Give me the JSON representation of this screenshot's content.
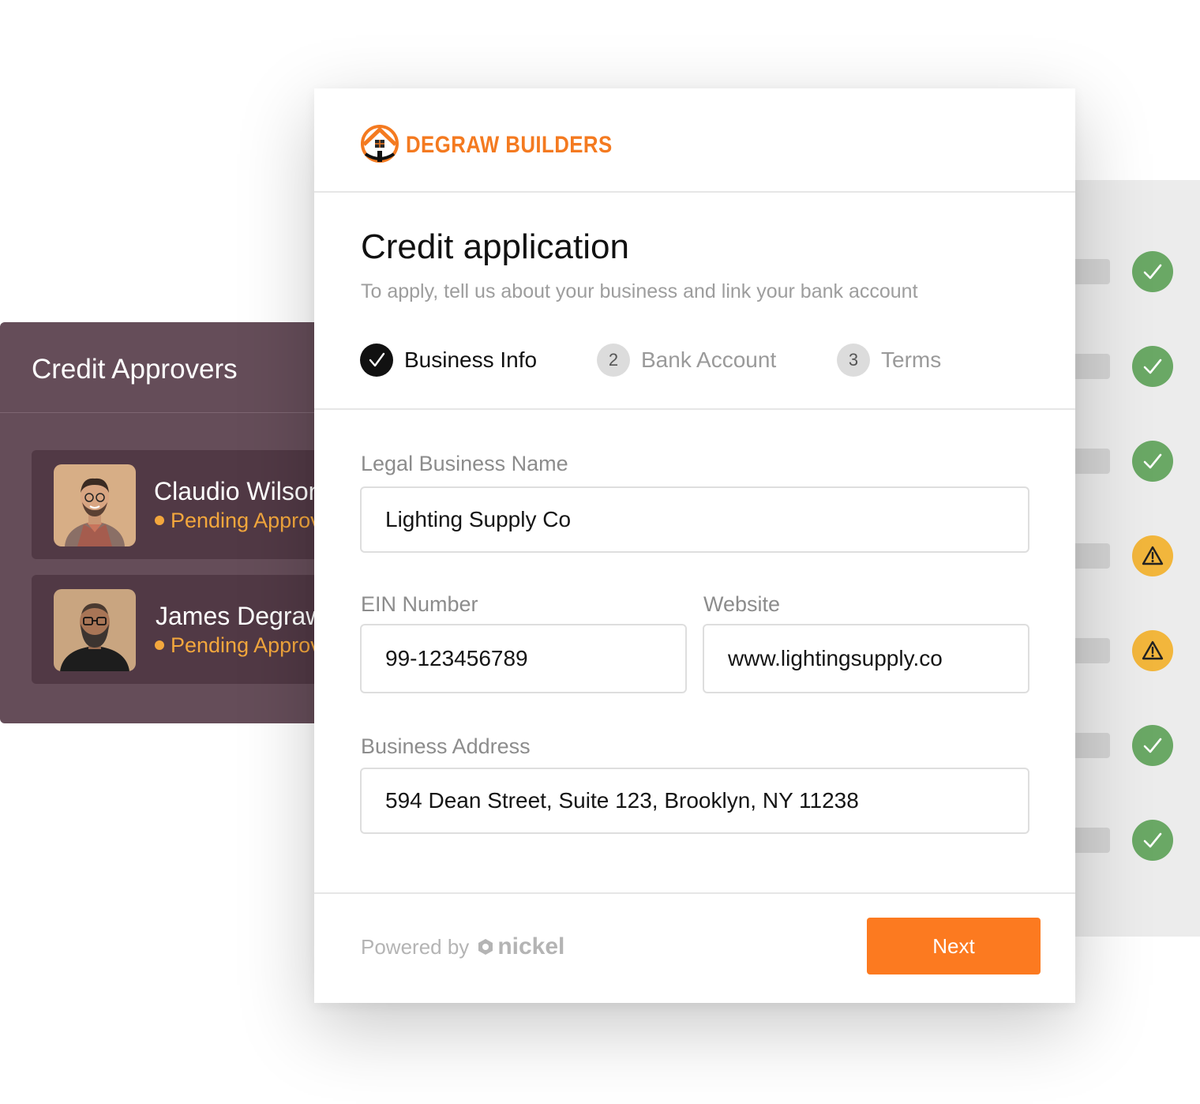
{
  "colors": {
    "brand": "#f47a20",
    "next_button": "#fc7a20",
    "approvers_panel": "#654d59",
    "approver_card": "#513945",
    "pending": "#f3a73d",
    "status_ok": "#6aa865",
    "status_warn": "#f2b63c"
  },
  "approvers": {
    "title": "Credit Approvers",
    "items": [
      {
        "name": "Claudio Wilson",
        "status": "Pending Approval",
        "avatar": "person-avatar"
      },
      {
        "name": "James Degraw",
        "status": "Pending Approval",
        "avatar": "person-avatar"
      }
    ]
  },
  "checklist": {
    "statuses": [
      "check-icon",
      "check-icon",
      "check-icon",
      "warning-icon",
      "warning-icon",
      "check-icon",
      "check-icon"
    ]
  },
  "dialog": {
    "brand_name": "DEGRAW BUILDERS",
    "brand_icon": "house-logo-icon",
    "title": "Credit application",
    "subtitle": "To apply, tell us about your business and link your bank account",
    "steps": [
      {
        "number": "",
        "label": "Business Info",
        "state": "done"
      },
      {
        "number": "2",
        "label": "Bank Account",
        "state": "todo"
      },
      {
        "number": "3",
        "label": "Terms",
        "state": "todo"
      }
    ],
    "fields": {
      "legal_name": {
        "label": "Legal Business Name",
        "value": "Lighting Supply Co"
      },
      "ein": {
        "label": "EIN Number",
        "value": "99-123456789"
      },
      "website": {
        "label": "Website",
        "value": "www.lightingsupply.co"
      },
      "address": {
        "label": "Business Address",
        "value": "594 Dean Street, Suite 123, Brooklyn, NY 11238"
      }
    },
    "footer": {
      "powered_by": "Powered by",
      "nickel_brand": "nickel",
      "next_label": "Next"
    }
  }
}
